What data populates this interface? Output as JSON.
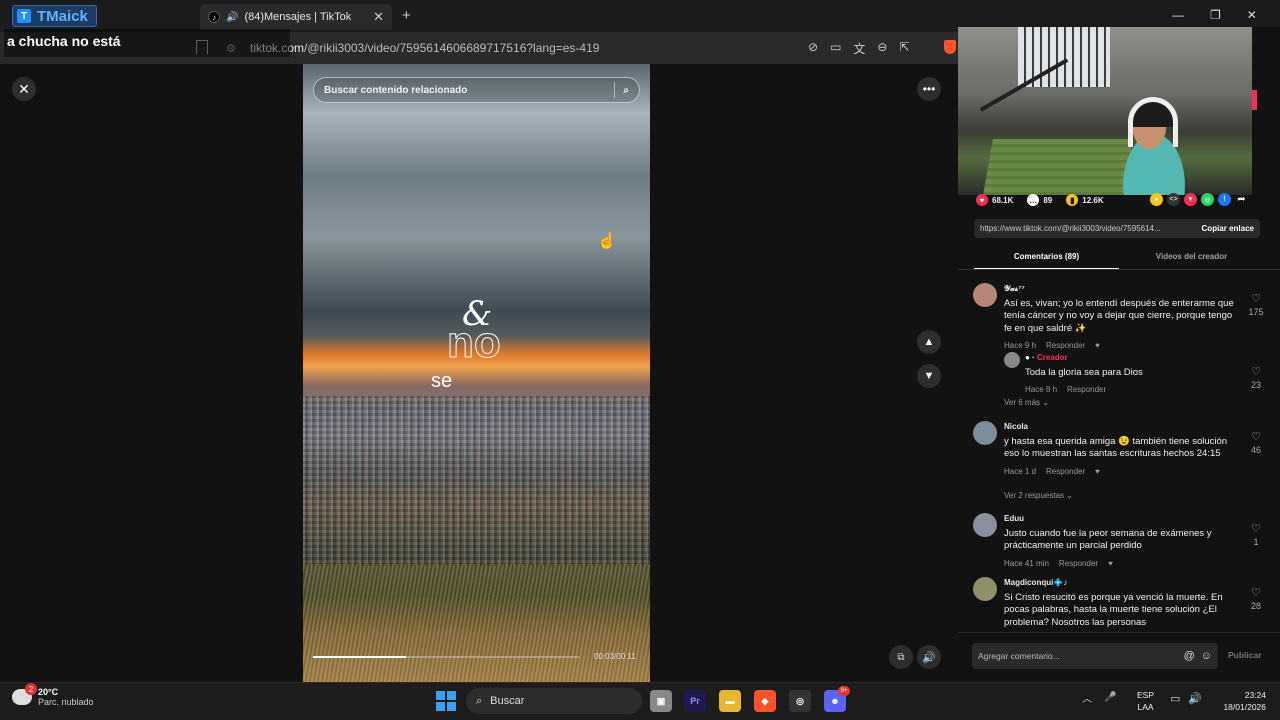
{
  "overlay": {
    "brand": "TMaick",
    "caption": "a chucha no está"
  },
  "browser": {
    "tab_title": "(84)Mensajes | TikTok",
    "url_host": "tiktok.com",
    "url_path": "/@rikii3003/video/7595614606689717516?lang=es-419"
  },
  "video": {
    "search_placeholder": "Buscar contenido relacionado",
    "lyric_amp": "&",
    "lyric_no": "no",
    "lyric_se": "se",
    "timecode": "00:03/00:11",
    "progress": 0.35
  },
  "stats": {
    "likes": "68.1K",
    "comments": "89",
    "saves": "12.6K"
  },
  "link": {
    "url": "https://www.tiktok.com/@rikii3003/video/7595614...",
    "copy_label": "Copiar enlace"
  },
  "tabs": {
    "comments": "Comentarios (89)",
    "creator_videos": "Videos del creador"
  },
  "comments": [
    {
      "user": "𝓨𝓪𝓼⁷⁷",
      "text": "Así es, vivan; yo lo entendí después de enterarme que tenía cáncer y no voy a dejar que cierre, porque tengo fe en que saldré ✨",
      "time": "Hace 9 h",
      "reply": "Responder",
      "likes": "175"
    },
    {
      "user_badge": "Creador",
      "text": "Toda la gloria sea para Dios",
      "time": "Hace 8 h",
      "reply": "Responder",
      "likes": "23"
    },
    {
      "user": "Nicola",
      "text": "y hasta esa querida amiga 😉 también tiene solución eso lo muestran las santas escrituras hechos 24:15",
      "time": "Hace 1 d",
      "reply": "Responder",
      "likes": "46"
    },
    {
      "user": "Eduu",
      "text": "Justo cuando fue la peor semana de exámenes y prácticamente un parcial perdido",
      "time": "Hace 41 min",
      "reply": "Responder",
      "likes": "1"
    },
    {
      "user": "Magdiconqui💠♪",
      "text": "Si Cristo resucitó es porque ya venció la muerte. En pocas palabras, hasta la muerte tiene solución ¿El problema? Nosotros las personas",
      "likes": "28"
    }
  ],
  "see_more": {
    "first": "Ver 6 más ⌄",
    "second": "Ver 2 respuestas ⌄"
  },
  "composer": {
    "placeholder": "Agregar comentario...",
    "publish": "Publicar"
  },
  "taskbar": {
    "weather_temp": "20°C",
    "weather_desc": "Parc. nublado",
    "weather_badge": "2",
    "search_label": "Buscar",
    "lang_top": "ESP",
    "lang_bottom": "LAA",
    "time": "23:24",
    "date": "18/01/2026",
    "discord_badge": "9+"
  },
  "colors": {
    "accent": "#fe2c55",
    "brand": "#5fb4ff"
  }
}
